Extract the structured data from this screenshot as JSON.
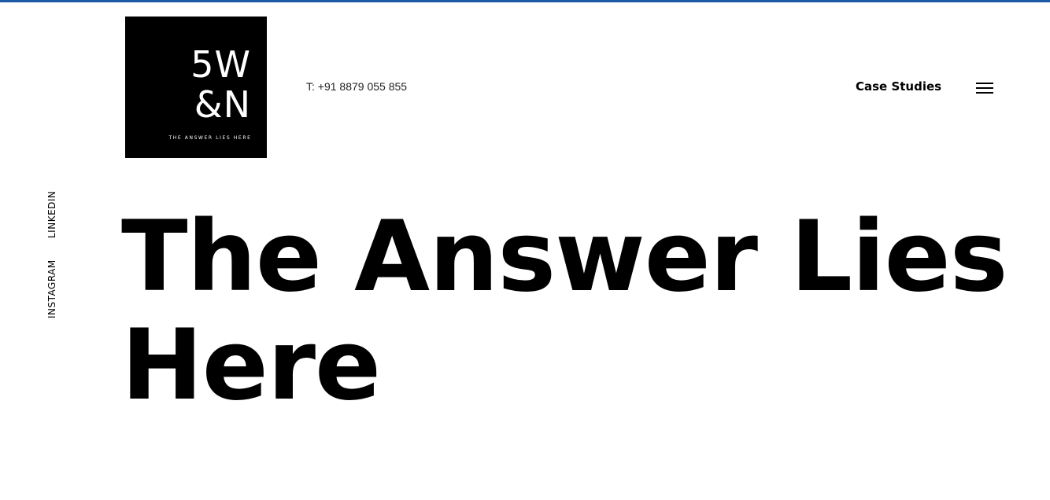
{
  "logo": {
    "line1": "5W",
    "line2": "&N",
    "tagline": "THE ANSWER LIES HERE"
  },
  "header": {
    "phone": "T: +91 8879 055 855",
    "case_studies": "Case Studies",
    "menu_icon": "hamburger-menu-icon"
  },
  "social": {
    "linkedin": "LINKEDIN",
    "instagram": "INSTAGRAM"
  },
  "hero": {
    "line1": "The Answer Lies",
    "line2": "Here"
  },
  "colors": {
    "top_bar": "#1f5aa6",
    "background": "#ffffff",
    "text": "#000000"
  }
}
